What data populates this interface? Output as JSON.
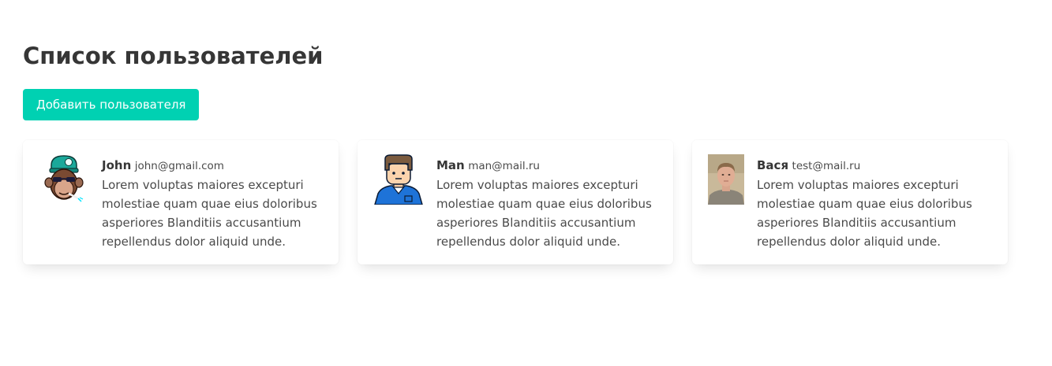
{
  "page": {
    "title": "Список пользователей",
    "add_button_label": "Добавить пользователя"
  },
  "colors": {
    "accent": "#00d1b2",
    "title": "#363636",
    "text": "#4a4a4a"
  },
  "users": [
    {
      "name": "John",
      "email": "john@gmail.com",
      "description": "Lorem voluptas maiores excepturi molestiae quam quae eius doloribus asperiores Blanditiis accusantium repellendus dolor aliquid unde.",
      "avatar_icon": "monkey-avatar-icon"
    },
    {
      "name": "Man",
      "email": "man@mail.ru",
      "description": "Lorem voluptas maiores excepturi molestiae quam quae eius doloribus asperiores Blanditiis accusantium repellendus dolor aliquid unde.",
      "avatar_icon": "man-avatar-icon"
    },
    {
      "name": "Вася",
      "email": "test@mail.ru",
      "description": "Lorem voluptas maiores excepturi molestiae quam quae eius doloribus asperiores Blanditiis accusantium repellendus dolor aliquid unde.",
      "avatar_icon": "photo-avatar"
    }
  ]
}
